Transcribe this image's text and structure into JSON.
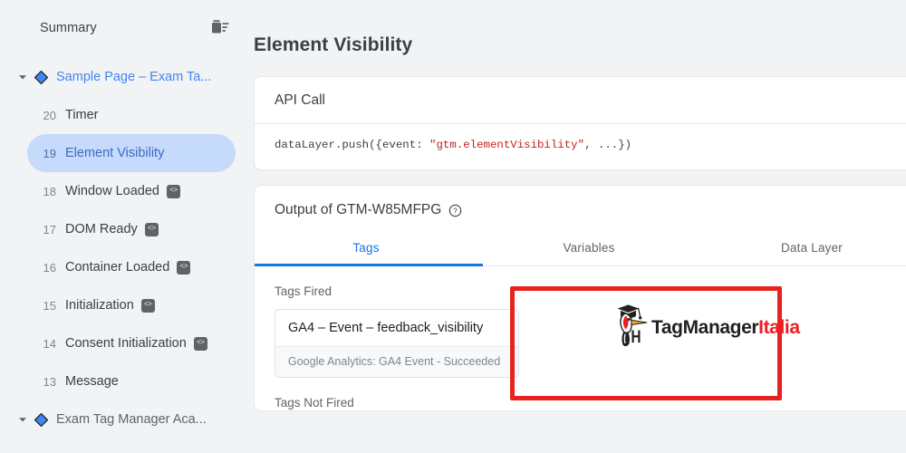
{
  "sidebar": {
    "title": "Summary",
    "clear_icon": "trash-icon",
    "groups_top": {
      "icon": "diamond-icon",
      "caret": "caret-down-icon",
      "label": "Sample Page – Exam Ta..."
    },
    "events": [
      {
        "num": "20",
        "name": "Timer",
        "badge": "",
        "selected": false
      },
      {
        "num": "19",
        "name": "Element Visibility",
        "badge": "",
        "selected": true
      },
      {
        "num": "18",
        "name": "Window Loaded",
        "badge": "<>",
        "selected": false
      },
      {
        "num": "17",
        "name": "DOM Ready",
        "badge": "<>",
        "selected": false
      },
      {
        "num": "16",
        "name": "Container Loaded",
        "badge": "<>",
        "selected": false
      },
      {
        "num": "15",
        "name": "Initialization",
        "badge": "<>",
        "selected": false
      },
      {
        "num": "14",
        "name": "Consent Initialization",
        "badge": "<>",
        "selected": false
      },
      {
        "num": "13",
        "name": "Message",
        "badge": "",
        "selected": false
      }
    ],
    "groups_bottom": {
      "icon": "diamond-icon",
      "caret": "caret-down-icon",
      "label": "Exam Tag Manager Aca..."
    }
  },
  "main": {
    "page_title": "Element Visibility",
    "api_card": {
      "heading": "API Call",
      "code_prefix": "dataLayer.push({event: ",
      "code_string": "\"gtm.elementVisibility\"",
      "code_suffix": ", ...})"
    },
    "output_card": {
      "heading": "Output of GTM-W85MFPG",
      "help_icon": "help-circle-icon",
      "tabs": [
        {
          "label": "Tags",
          "active": true
        },
        {
          "label": "Variables",
          "active": false
        },
        {
          "label": "Data Layer",
          "active": false
        }
      ],
      "tags_fired_label": "Tags Fired",
      "fired_tag": {
        "name": "GA4 – Event – feedback_visibility",
        "status": "Google Analytics: GA4 Event - Succeeded"
      },
      "tags_not_fired_label": "Tags Not Fired"
    },
    "logo": {
      "mark": "woodpecker-graduate-icon",
      "word_dark": "TagManager",
      "word_red": "Italia"
    }
  },
  "colors": {
    "accent_blue": "#1a73e8",
    "link_blue": "#4285f4",
    "selected_pill": "#c6dafc",
    "sidebar_bg": "#f1f3f4",
    "code_string_red": "#c5221f",
    "annotation_red": "#e8221f",
    "logo_red": "#ed1c24"
  },
  "annotation": {
    "shape": "red-rectangle-highlight"
  }
}
